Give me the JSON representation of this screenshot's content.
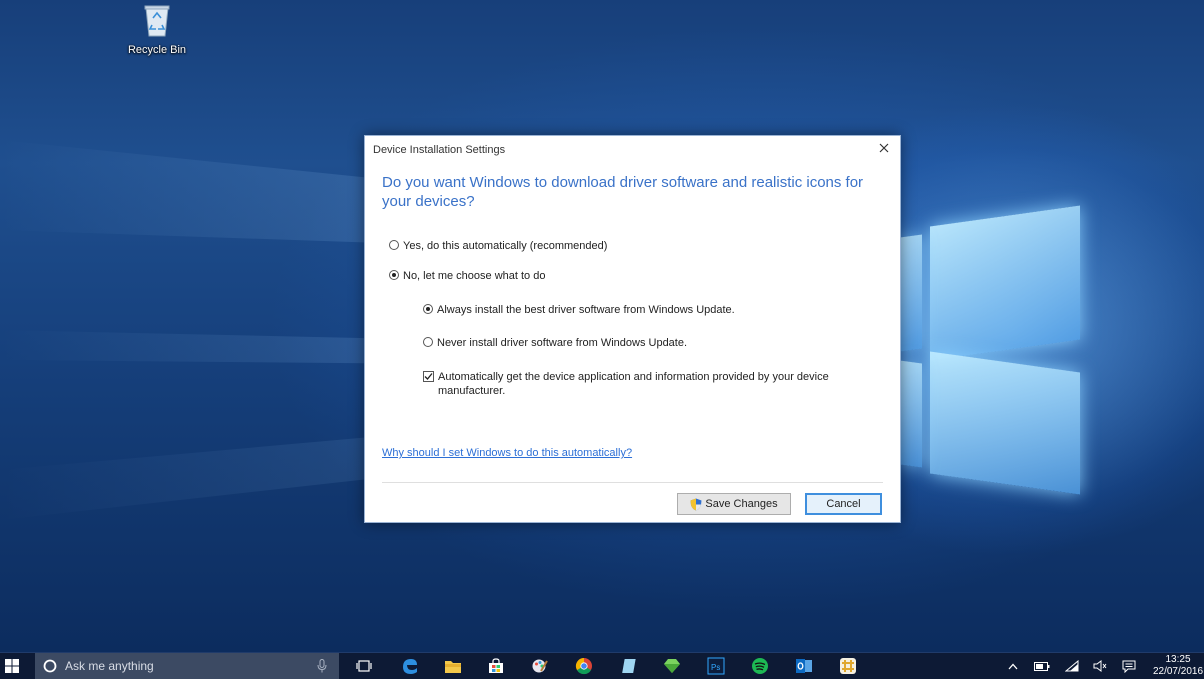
{
  "desktop": {
    "recycle_bin_label": "Recycle Bin"
  },
  "dialog": {
    "title": "Device Installation Settings",
    "heading": "Do you want Windows to download driver software and realistic icons for your devices?",
    "options": {
      "yes_auto": {
        "label": "Yes, do this automatically (recommended)",
        "selected": false
      },
      "no_choose": {
        "label": "No, let me choose what to do",
        "selected": true
      },
      "always_install": {
        "label": "Always install the best driver software from Windows Update.",
        "selected": true
      },
      "never_install": {
        "label": "Never install driver software from Windows Update.",
        "selected": false
      },
      "auto_get_app": {
        "label": "Automatically get the device application and information provided by your device manufacturer.",
        "checked": true
      }
    },
    "help_link": "Why should I set Windows to do this automatically?",
    "save_button": "Save Changes",
    "cancel_button": "Cancel"
  },
  "taskbar": {
    "search_placeholder": "Ask me anything",
    "pinned_apps": [
      "task-view",
      "edge",
      "file-explorer",
      "store",
      "paint",
      "chrome",
      "notepad",
      "gem",
      "photoshop",
      "spotify",
      "outlook",
      "slack"
    ],
    "time": "13:25",
    "date": "22/07/2016"
  },
  "colors": {
    "heading": "#3a72c8",
    "link": "#2c6fd6",
    "taskbar": "#0e1a34"
  }
}
